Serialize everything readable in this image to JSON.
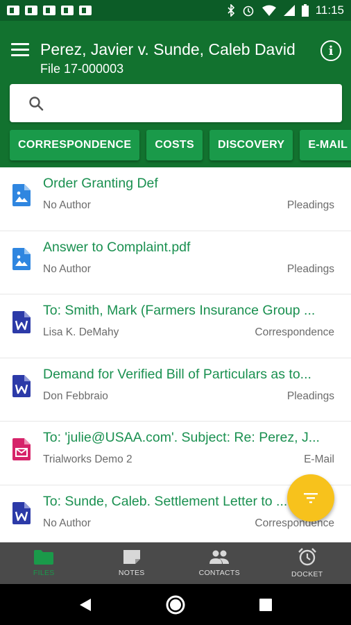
{
  "status_bar": {
    "time": "11:15",
    "app_icons": [
      "teams-icon",
      "teams-icon",
      "teams-icon",
      "image-icon",
      "outlook-icon"
    ],
    "system_icons": [
      "bluetooth-icon",
      "alarm-icon",
      "wifi-icon",
      "signal-icon",
      "battery-icon"
    ]
  },
  "header": {
    "title": "Perez, Javier v. Sunde, Caleb David",
    "file_number": "File 17-000003",
    "background_color": "#12722f"
  },
  "search": {
    "value": "",
    "placeholder": ""
  },
  "chips": [
    {
      "label": "CORRESPONDENCE"
    },
    {
      "label": "COSTS"
    },
    {
      "label": "DISCOVERY"
    },
    {
      "label": "E-MAIL"
    }
  ],
  "documents": [
    {
      "title": "Order Granting Def",
      "author": "No Author",
      "category": "Pleadings",
      "icon": "image-file-icon"
    },
    {
      "title": "Answer to Complaint.pdf",
      "author": "No Author",
      "category": "Pleadings",
      "icon": "image-file-icon"
    },
    {
      "title": "To: Smith, Mark (Farmers Insurance Group ...",
      "author": "Lisa K. DeMahy",
      "category": "Correspondence",
      "icon": "word-file-icon"
    },
    {
      "title": "Demand for Verified Bill of Particulars as to...",
      "author": "Don Febbraio",
      "category": "Pleadings",
      "icon": "word-file-icon"
    },
    {
      "title": "To: 'julie@USAA.com'.  Subject: Re: Perez, J...",
      "author": "Trialworks Demo 2",
      "category": "E-Mail",
      "icon": "email-file-icon"
    },
    {
      "title": "To: Sunde, Caleb.  Settlement Letter to ...",
      "author": "No Author",
      "category": "Correspondence",
      "icon": "word-file-icon"
    }
  ],
  "fab": {
    "icon": "filter-icon",
    "color": "#f7c21c"
  },
  "bottom_nav": [
    {
      "label": "FILES",
      "icon": "folder-icon",
      "active": true
    },
    {
      "label": "NOTES",
      "icon": "note-icon",
      "active": false
    },
    {
      "label": "CONTACTS",
      "icon": "people-icon",
      "active": false
    },
    {
      "label": "DOCKET",
      "icon": "alarm-icon",
      "active": false
    }
  ],
  "system_nav": [
    "back-icon",
    "home-icon",
    "recents-icon"
  ]
}
